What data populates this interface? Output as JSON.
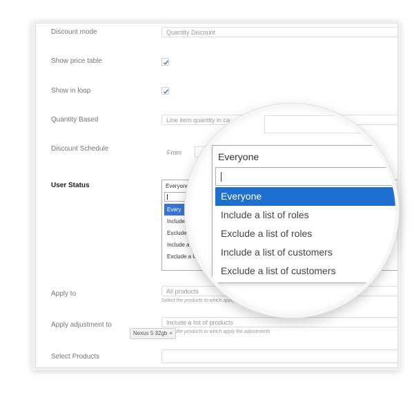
{
  "form": {
    "discount_mode": {
      "label": "Discount mode",
      "value": "Quantity Discount"
    },
    "show_price_table": {
      "label": "Show price table",
      "checked": true
    },
    "show_in_loop": {
      "label": "Show in loop",
      "checked": true
    },
    "quantity_based": {
      "label": "Quantity Based",
      "value": "Line item quantity in ca"
    },
    "discount_schedule": {
      "label": "Discount Schedule",
      "from_label": "From"
    },
    "user_status": {
      "label": "User Status",
      "selected": "Everyone",
      "small_options": [
        "Every",
        "Include",
        "Exclude",
        "Include a",
        "Exclude a li"
      ]
    },
    "apply_to": {
      "label": "Apply to",
      "value": "All products",
      "hint": "Select the products to which apply"
    },
    "apply_adjustment_to": {
      "label": "Apply adjustment to",
      "value": "Include a list of products",
      "hint": "Select the products to which apply the adjustments"
    },
    "select_products": {
      "label": "Select Products",
      "tag": "Nexus 5 32gb",
      "tag_remove": "×"
    }
  },
  "magnifier": {
    "selected": "Everyone",
    "search_value": "",
    "options": [
      "Everyone",
      "Include a list of roles",
      "Exclude a list of roles",
      "Include a list of customers",
      "Exclude a list of customers"
    ],
    "highlighted_index": 0
  },
  "colors": {
    "highlight": "#1e6fd0",
    "checkmark": "#3a6fb5"
  },
  "icons": {
    "checkbox": "checkmark-icon",
    "tag_remove": "close-icon"
  }
}
